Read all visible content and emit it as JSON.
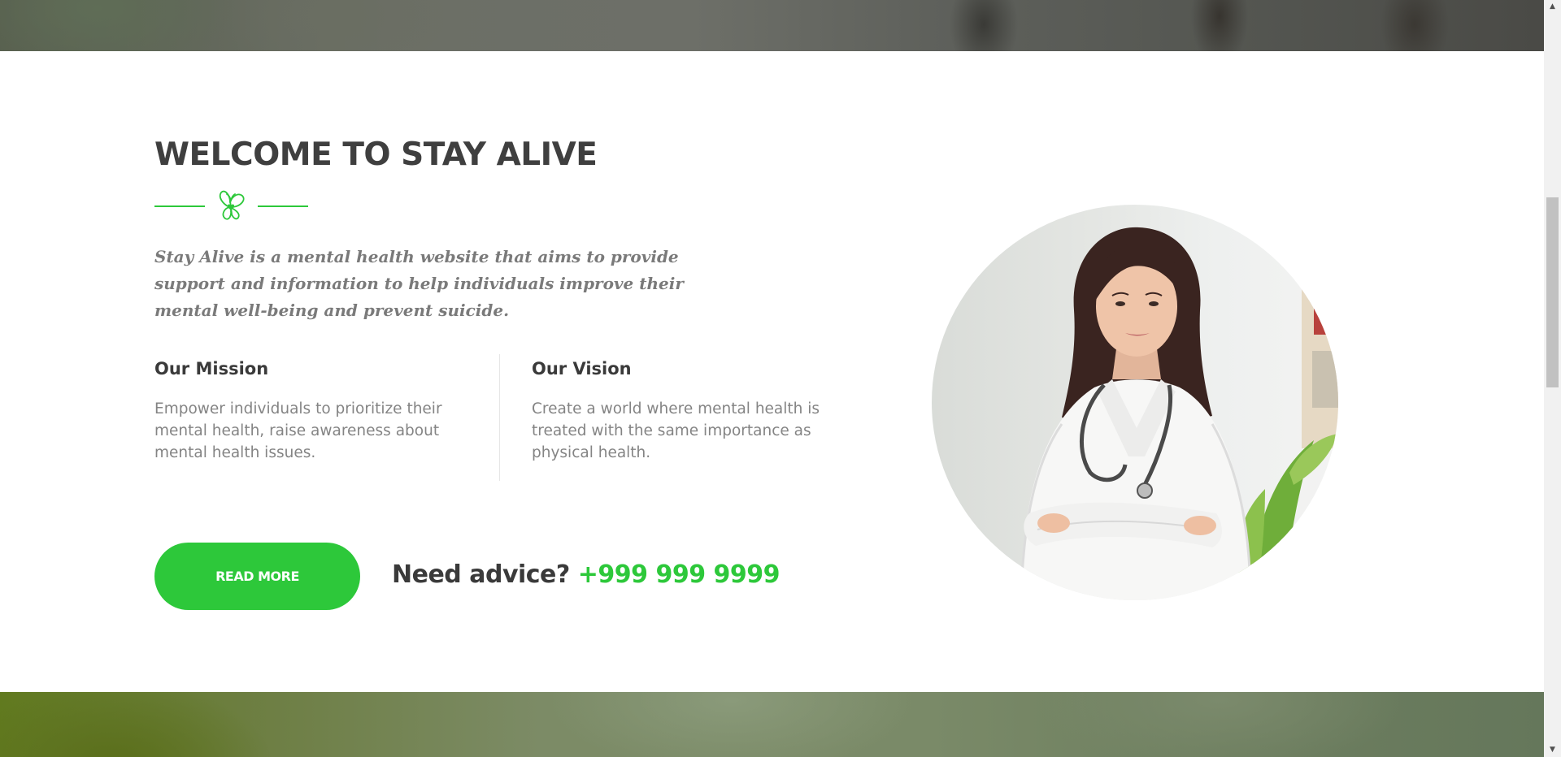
{
  "welcome": {
    "title": "WELCOME TO STAY ALIVE",
    "intro": "Stay Alive is a mental health website that aims to provide support and information to help individuals improve their mental well-being and prevent suicide."
  },
  "mission": {
    "heading": "Our Mission",
    "text": "Empower individuals to prioritize their mental health, raise awareness about mental health issues."
  },
  "vision": {
    "heading": "Our Vision",
    "text": "Create a world where mental health is treated with the same importance as physical health."
  },
  "cta": {
    "read_more_label": "READ MORE",
    "advice_label": "Need advice?",
    "phone": "+999 999 9999"
  },
  "colors": {
    "accent": "#2dc83a",
    "heading": "#3f3f3f",
    "body_text": "#848484"
  },
  "icons": {
    "divider": "butterfly-icon"
  }
}
